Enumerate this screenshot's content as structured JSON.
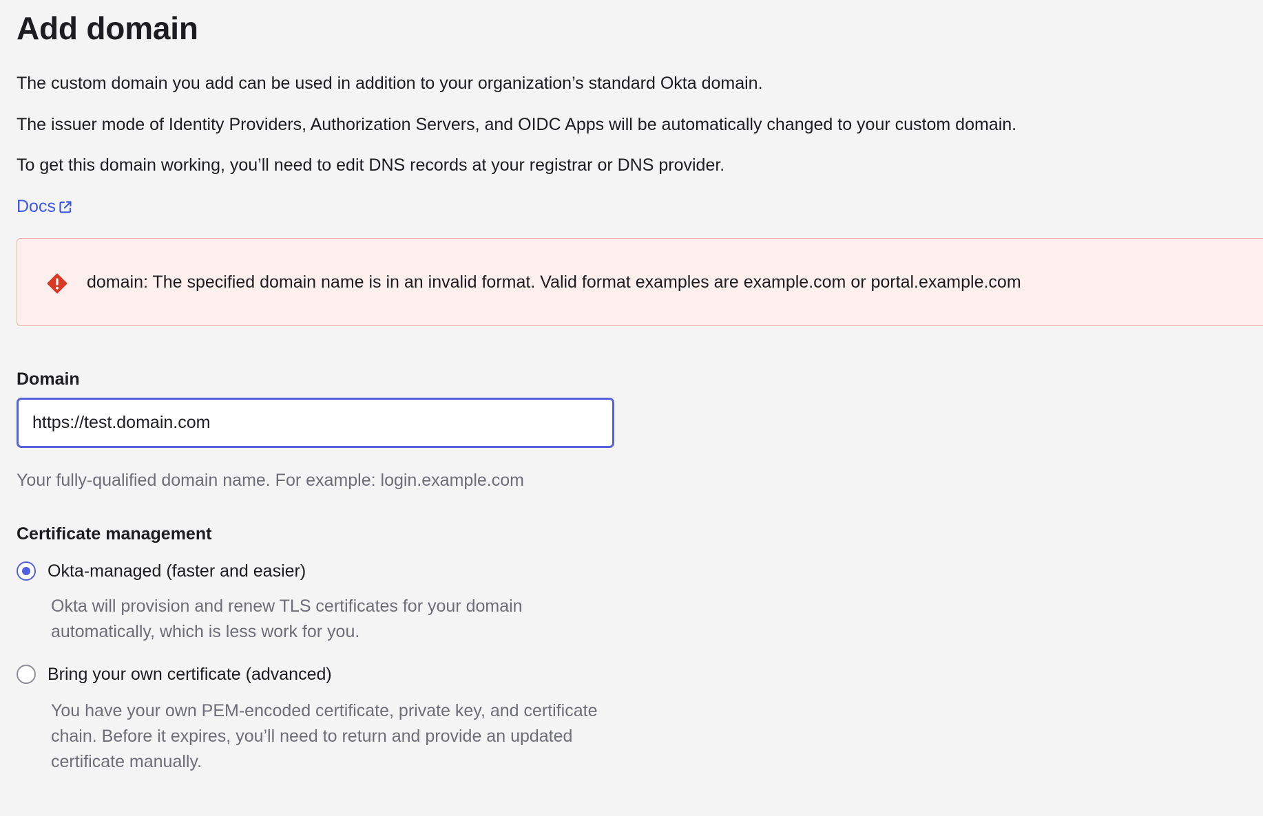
{
  "page": {
    "title": "Add domain",
    "intro": [
      "The custom domain you add can be used in addition to your organization’s standard Okta domain.",
      "The issuer mode of Identity Providers, Authorization Servers, and OIDC Apps will be automatically changed to your custom domain.",
      "To get this domain working, you’ll need to edit DNS records at your registrar or DNS provider."
    ],
    "docs_link": {
      "label": "Docs",
      "icon": "external-link-icon"
    }
  },
  "alert": {
    "icon": "error-diamond-icon",
    "message": "domain: The specified domain name is in an invalid format. Valid format examples are example.com or portal.example.com",
    "colors": {
      "background": "#fdefed",
      "border": "#f1b2aa",
      "icon": "#d93a26"
    }
  },
  "domain_field": {
    "label": "Domain",
    "value": "https://test.domain.com",
    "hint": "Your fully-qualified domain name. For example: login.example.com"
  },
  "certificate": {
    "label": "Certificate management",
    "options": [
      {
        "label": "Okta-managed (faster and easier)",
        "description": "Okta will provision and renew TLS certificates for your domain automatically, which is less work for you.",
        "selected": true
      },
      {
        "label": "Bring your own certificate (advanced)",
        "description": "You have your own PEM-encoded certificate, private key, and certificate chain. Before it expires, you’ll need to return and provide an updated certificate manually.",
        "selected": false
      }
    ]
  },
  "colors": {
    "accent": "#4f5fe0",
    "link": "#3f59e4",
    "text": "#1d1d21",
    "muted_text": "#6e6e78",
    "background": "#f4f4f4"
  }
}
